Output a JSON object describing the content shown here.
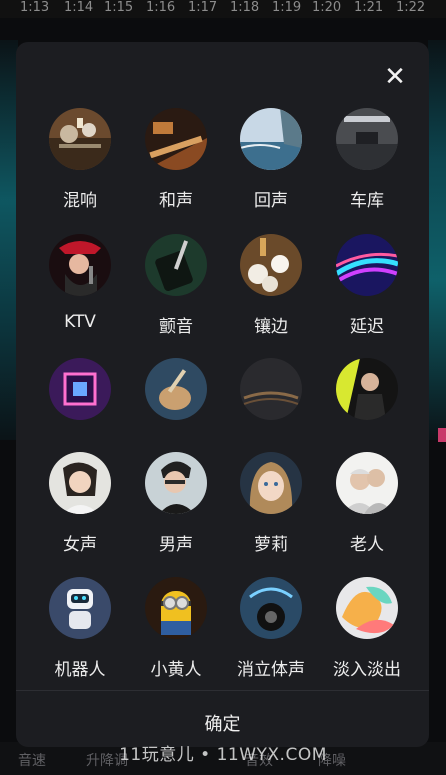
{
  "timeline": {
    "ticks": [
      "1:13",
      "1:14",
      "1:15",
      "1:16",
      "1:17",
      "1:18",
      "1:19",
      "1:20",
      "1:21",
      "1:22"
    ]
  },
  "panel": {
    "close_icon": "close-icon",
    "confirm_label": "确定",
    "effects": [
      {
        "label": "混响",
        "icon": "reverb-image"
      },
      {
        "label": "和声",
        "icon": "harmony-image"
      },
      {
        "label": "回声",
        "icon": "echo-image"
      },
      {
        "label": "车库",
        "icon": "garage-image"
      },
      {
        "label": "KTV",
        "icon": "ktv-image"
      },
      {
        "label": "颤音",
        "icon": "vibrato-image"
      },
      {
        "label": "镶边",
        "icon": "flanger-image"
      },
      {
        "label": "延迟",
        "icon": "delay-image"
      },
      {
        "label": "",
        "icon": "tunnel-image"
      },
      {
        "label": "",
        "icon": "guitar-image"
      },
      {
        "label": "",
        "icon": "rain-image"
      },
      {
        "label": "",
        "icon": "singer-image"
      },
      {
        "label": "女声",
        "icon": "female-voice-image"
      },
      {
        "label": "男声",
        "icon": "male-voice-image"
      },
      {
        "label": "萝莉",
        "icon": "loli-image"
      },
      {
        "label": "老人",
        "icon": "elder-image"
      },
      {
        "label": "机器人",
        "icon": "robot-image"
      },
      {
        "label": "小黄人",
        "icon": "minion-image"
      },
      {
        "label": "消立体声",
        "icon": "remove-stereo-image"
      },
      {
        "label": "淡入淡出",
        "icon": "fade-image"
      }
    ]
  },
  "bottom_tabs": [
    "音速",
    "升降调",
    "",
    "音效",
    "降噪"
  ],
  "watermark": "11玩意儿 • 11WYX.COM"
}
